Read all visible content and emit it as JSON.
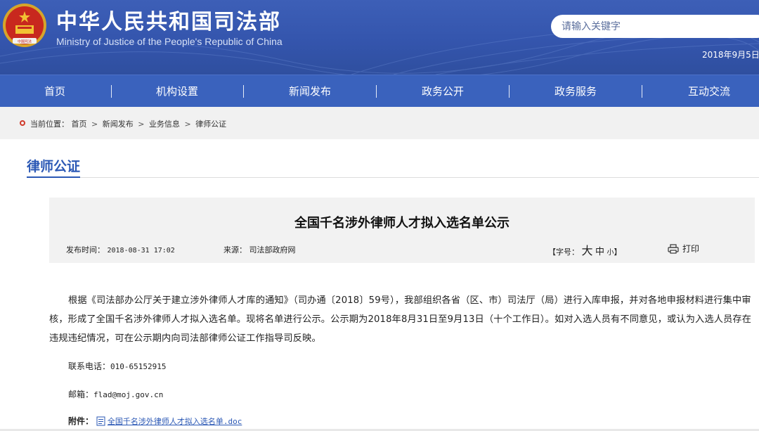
{
  "header": {
    "title": "中华人民共和国司法部",
    "subtitle": "Ministry of Justice of the People's Republic of China",
    "search_placeholder": "请输入关键字",
    "date": "2018年9月5日"
  },
  "nav": {
    "items": [
      "首页",
      "机构设置",
      "新闻发布",
      "政务公开",
      "政务服务",
      "互动交流"
    ]
  },
  "breadcrumb": {
    "prefix": "当前位置：",
    "items": [
      "首页",
      "新闻发布",
      "业务信息",
      "律师公证"
    ],
    "separator": ">"
  },
  "section": {
    "title": "律师公证"
  },
  "article": {
    "title": "全国千名涉外律师人才拟入选名单公示",
    "publish_label": "发布时间：",
    "publish_time": "2018-08-31 17:02",
    "source_label": "来源：",
    "source": "司法部政府网",
    "fontsize_open": "【字号：",
    "fontsize_big": "大",
    "fontsize_mid": "中",
    "fontsize_small": "小",
    "fontsize_close": "】",
    "print_label": "打印",
    "body": "根据《司法部办公厅关于建立涉外律师人才库的通知》（司办通〔2018〕59号），我部组织各省（区、市）司法厅（局）进行入库申报，并对各地申报材料进行集中审核，形成了全国千名涉外律师人才拟入选名单。现将名单进行公示。公示期为2018年8月31日至9月13日（十个工作日）。如对入选人员有不同意见，或认为入选人员存在违规违纪情况，可在公示期内向司法部律师公证工作指导司反映。",
    "phone_label": "联系电话：",
    "phone": "010-65152915",
    "email_label": "邮箱：",
    "email": "flad@moj.gov.cn",
    "attachment_label": "附件：",
    "attachment_name": "全国千名涉外律师人才拟入选名单.doc"
  },
  "colors": {
    "header_blue": "#3455ad",
    "nav_blue": "#3a62bd",
    "accent_blue": "#2b58b5",
    "emblem_red": "#c8281e",
    "emblem_gold": "#f2c233"
  }
}
